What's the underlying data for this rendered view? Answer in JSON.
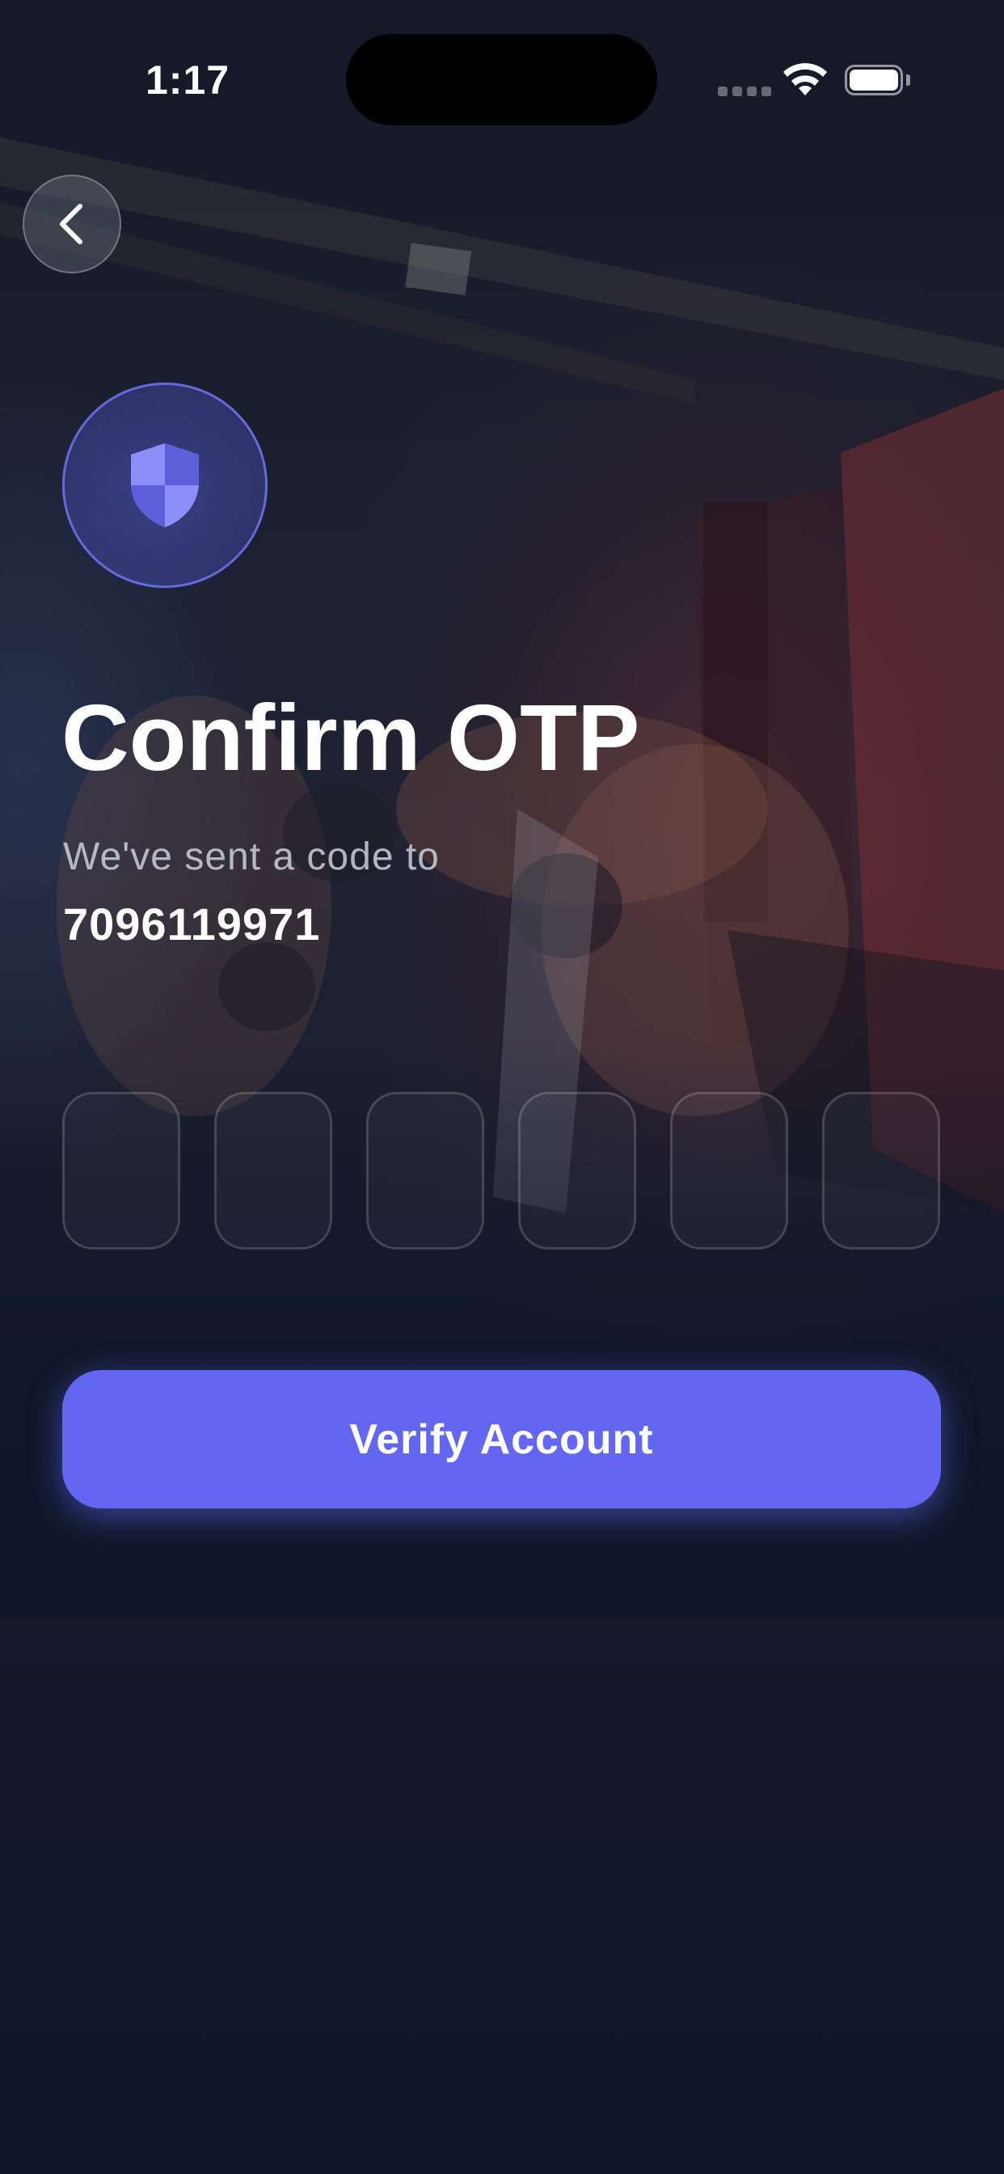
{
  "status_bar": {
    "time": "1:17"
  },
  "nav": {
    "back_icon": "chevron-left-icon"
  },
  "hero": {
    "icon": "shield-icon",
    "accent_color": "#6366f1"
  },
  "title": "Confirm OTP",
  "subtitle": "We've sent a code to",
  "phone_number": "7096119971",
  "otp": {
    "digits": [
      "",
      "",
      "",
      "",
      "",
      ""
    ]
  },
  "verify_button": {
    "label": "Verify Account"
  }
}
